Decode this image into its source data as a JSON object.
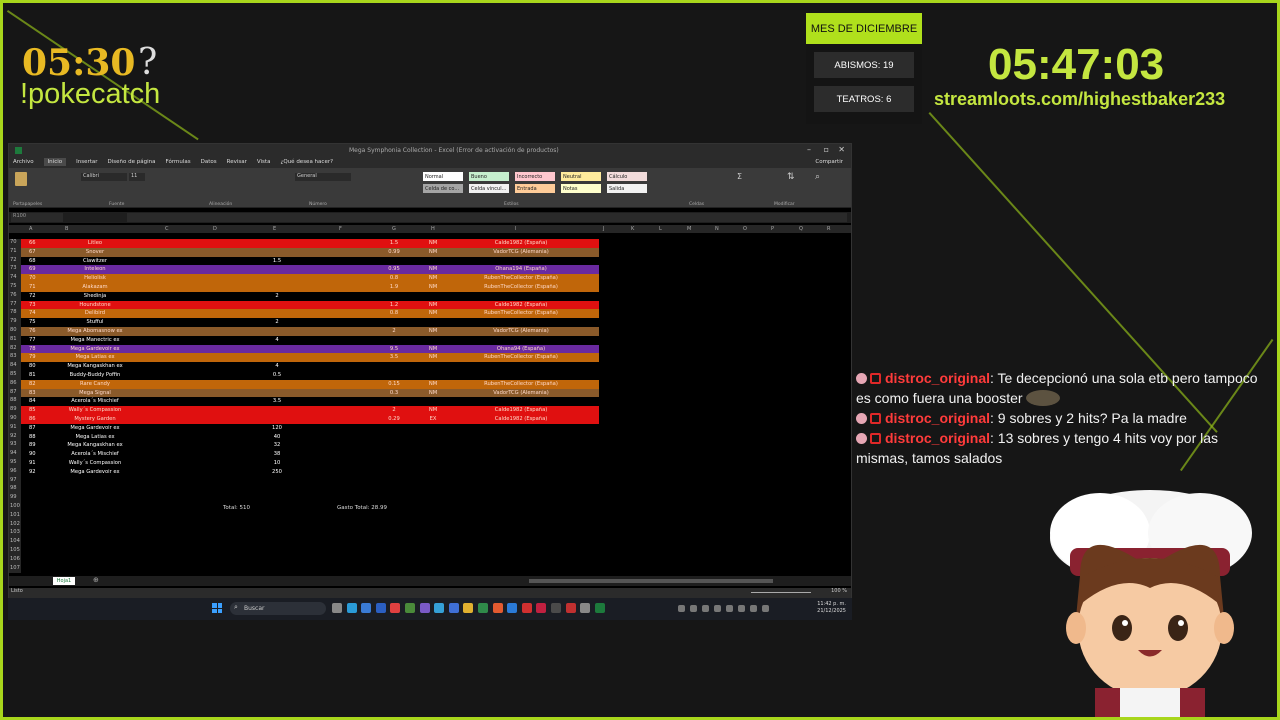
{
  "overlay": {
    "timer_left": "05:30",
    "question_mark": "?",
    "command": "!pokecatch",
    "month_label": "MES DE DICIEMBRE",
    "abismos": "ABISMOS: 19",
    "teatros": "TEATROS: 6",
    "big_clock": "05:47:03",
    "streamloots": "streamloots.com/highestbaker233",
    "accent_color": "#b0e01c"
  },
  "excel": {
    "title": "Mega Symphonia Collection - Excel (Error de activación de productos)",
    "menu": [
      "Archivo",
      "Inicio",
      "Insertar",
      "Diseño de página",
      "Fórmulas",
      "Datos",
      "Revisar",
      "Vista",
      "¿Qué desea hacer?"
    ],
    "share": "Compartir",
    "styles": [
      {
        "label": "Normal",
        "bg": "#ffffff"
      },
      {
        "label": "Bueno",
        "bg": "#c6efce"
      },
      {
        "label": "Incorrecto",
        "bg": "#ffc7ce"
      },
      {
        "label": "Neutral",
        "bg": "#ffeb9c"
      },
      {
        "label": "Cálculo",
        "bg": "#f2dcdb"
      },
      {
        "label": "Celda de co...",
        "bg": "#a5a5a5"
      },
      {
        "label": "Celda vincul...",
        "bg": "#f2f2f2"
      },
      {
        "label": "Entrada",
        "bg": "#ffcc99"
      },
      {
        "label": "Notas",
        "bg": "#ffffcc"
      },
      {
        "label": "Salida",
        "bg": "#f2f2f2"
      }
    ],
    "ribbon_groups": [
      "Portapapeles",
      "Fuente",
      "Alineación",
      "Número",
      "Estilos",
      "Celdas",
      "Modificar"
    ],
    "font_name": "Calibri",
    "font_size": "11",
    "number_format": "General",
    "name_box": "R100",
    "columns": [
      "A",
      "B",
      "C",
      "D",
      "E",
      "F",
      "G",
      "H",
      "I",
      "J",
      "K",
      "L",
      "M",
      "N",
      "O",
      "P",
      "Q",
      "R"
    ],
    "rows": [
      {
        "rn": "70",
        "a": "66",
        "b": "Litleo",
        "e": "",
        "g": "1.5",
        "h": "NM",
        "i": "Calde1982 (España)",
        "color": "#e01010"
      },
      {
        "rn": "71",
        "a": "67",
        "b": "Snover",
        "e": "",
        "g": "0.99",
        "h": "NM",
        "i": "VadorTCG (Alemania)",
        "color": "#8a5a2a"
      },
      {
        "rn": "72",
        "a": "68",
        "b": "Clawitzer",
        "e": "1.5",
        "g": "",
        "h": "",
        "i": "",
        "color": ""
      },
      {
        "rn": "73",
        "a": "69",
        "b": "Inteleon",
        "e": "",
        "g": "0.95",
        "h": "NM",
        "i": "Ohana194 (España)",
        "color": "#6a2aa0"
      },
      {
        "rn": "74",
        "a": "70",
        "b": "Heliolisk",
        "e": "",
        "g": "0.8",
        "h": "NM",
        "i": "RubenTheCollector (España)",
        "color": "#c0660a"
      },
      {
        "rn": "75",
        "a": "71",
        "b": "Alakazam",
        "e": "",
        "g": "1.9",
        "h": "NM",
        "i": "RubenTheCollector (España)",
        "color": "#c0660a"
      },
      {
        "rn": "76",
        "a": "72",
        "b": "Shedinja",
        "e": "2",
        "g": "",
        "h": "",
        "i": "",
        "color": ""
      },
      {
        "rn": "77",
        "a": "73",
        "b": "Houndstone",
        "e": "",
        "g": "1.2",
        "h": "NM",
        "i": "Calde1982 (España)",
        "color": "#e01010"
      },
      {
        "rn": "78",
        "a": "74",
        "b": "Delibird",
        "e": "",
        "g": "0.8",
        "h": "NM",
        "i": "RubenTheCollector (España)",
        "color": "#c0660a"
      },
      {
        "rn": "79",
        "a": "75",
        "b": "Stufful",
        "e": "2",
        "g": "",
        "h": "",
        "i": "",
        "color": ""
      },
      {
        "rn": "80",
        "a": "76",
        "b": "Mega Abomasnow ex",
        "e": "",
        "g": "2",
        "h": "NM",
        "i": "VadorTCG (Alemania)",
        "color": "#8a5a2a"
      },
      {
        "rn": "81",
        "a": "77",
        "b": "Mega Manectric ex",
        "e": "4",
        "g": "",
        "h": "",
        "i": "",
        "color": ""
      },
      {
        "rn": "82",
        "a": "78",
        "b": "Mega Gardevoir ex",
        "e": "",
        "g": "9.5",
        "h": "NM",
        "i": "Ohana94 (España)",
        "color": "#6a2aa0"
      },
      {
        "rn": "83",
        "a": "79",
        "b": "Mega Latias ex",
        "e": "",
        "g": "3.5",
        "h": "NM",
        "i": "RubenTheCollector (España)",
        "color": "#c0660a"
      },
      {
        "rn": "84",
        "a": "80",
        "b": "Mega Kangaskhan ex",
        "e": "4",
        "g": "",
        "h": "",
        "i": "",
        "color": ""
      },
      {
        "rn": "85",
        "a": "81",
        "b": "Buddy-Buddy Poffin",
        "e": "0.5",
        "g": "",
        "h": "",
        "i": "",
        "color": ""
      },
      {
        "rn": "86",
        "a": "82",
        "b": "Rare Candy",
        "e": "",
        "g": "0.15",
        "h": "NM",
        "i": "RubenTheCollector (España)",
        "color": "#c0660a"
      },
      {
        "rn": "87",
        "a": "83",
        "b": "Mega Signal",
        "e": "",
        "g": "0.3",
        "h": "NM",
        "i": "VadorTCG (Alemania)",
        "color": "#8a5a2a"
      },
      {
        "rn": "88",
        "a": "84",
        "b": "Acerola´s Mischief",
        "e": "3.5",
        "g": "",
        "h": "",
        "i": "",
        "color": ""
      },
      {
        "rn": "89",
        "a": "85",
        "b": "Wally´s Compassion",
        "e": "",
        "g": "2",
        "h": "NM",
        "i": "Calde1982 (España)",
        "color": "#e01010"
      },
      {
        "rn": "90",
        "a": "86",
        "b": "Mystery Garden",
        "e": "",
        "g": "0.29",
        "h": "EX",
        "i": "Calde1982 (España)",
        "color": "#e01010"
      },
      {
        "rn": "91",
        "a": "87",
        "b": "Mega Gardevoir ex",
        "e": "120",
        "g": "",
        "h": "",
        "i": "",
        "color": ""
      },
      {
        "rn": "92",
        "a": "88",
        "b": "Mega Latias ex",
        "e": "40",
        "g": "",
        "h": "",
        "i": "",
        "color": ""
      },
      {
        "rn": "93",
        "a": "89",
        "b": "Mega Kangaskhan ex",
        "e": "32",
        "g": "",
        "h": "",
        "i": "",
        "color": ""
      },
      {
        "rn": "94",
        "a": "90",
        "b": "Acerola´s Mischief",
        "e": "38",
        "g": "",
        "h": "",
        "i": "",
        "color": ""
      },
      {
        "rn": "95",
        "a": "91",
        "b": "Wally´s Compassion",
        "e": "10",
        "g": "",
        "h": "",
        "i": "",
        "color": ""
      },
      {
        "rn": "96",
        "a": "92",
        "b": "Mega Gardevoir ex",
        "e": "250",
        "g": "",
        "h": "",
        "i": "",
        "color": ""
      },
      {
        "rn": "97",
        "a": "",
        "b": "",
        "e": "",
        "g": "",
        "h": "",
        "i": "",
        "color": ""
      },
      {
        "rn": "98",
        "a": "",
        "b": "",
        "e": "",
        "g": "",
        "h": "",
        "i": "",
        "color": ""
      },
      {
        "rn": "99",
        "a": "",
        "b": "",
        "e": "",
        "g": "",
        "h": "",
        "i": "",
        "color": ""
      },
      {
        "rn": "100",
        "a": "",
        "b": "",
        "e": "",
        "g": "",
        "h": "",
        "i": "",
        "color": ""
      },
      {
        "rn": "101",
        "a": "",
        "b": "",
        "e": "",
        "g": "",
        "h": "",
        "i": "",
        "color": ""
      },
      {
        "rn": "102",
        "a": "",
        "b": "",
        "e": "",
        "g": "",
        "h": "",
        "i": "",
        "color": ""
      },
      {
        "rn": "103",
        "a": "",
        "b": "",
        "e": "",
        "g": "",
        "h": "",
        "i": "",
        "color": ""
      },
      {
        "rn": "104",
        "a": "",
        "b": "",
        "e": "",
        "g": "",
        "h": "",
        "i": "",
        "color": ""
      },
      {
        "rn": "105",
        "a": "",
        "b": "",
        "e": "",
        "g": "",
        "h": "",
        "i": "",
        "color": ""
      },
      {
        "rn": "106",
        "a": "",
        "b": "",
        "e": "",
        "g": "",
        "h": "",
        "i": "",
        "color": ""
      },
      {
        "rn": "107",
        "a": "",
        "b": "",
        "e": "",
        "g": "",
        "h": "",
        "i": "",
        "color": ""
      }
    ],
    "total": "Total: 510",
    "gasto_total": "Gasto Total: 28.99",
    "sheet_tab": "Hoja1",
    "status": "Listo",
    "zoom": "100 %"
  },
  "taskbar": {
    "search": "Buscar",
    "time": "11:42 p. m.",
    "date": "21/12/2025"
  },
  "chat": {
    "messages": [
      {
        "user": "distroc_original",
        "text": ": Te decepcionó una sola etb pero tampoco es como fuera una booster"
      },
      {
        "user": "distroc_original",
        "text": ": 9 sobres y 2 hits? Pa la madre"
      },
      {
        "user": "distroc_original",
        "text": ": 13 sobres y tengo 4 hits voy por las mismas, tamos salados"
      }
    ]
  }
}
